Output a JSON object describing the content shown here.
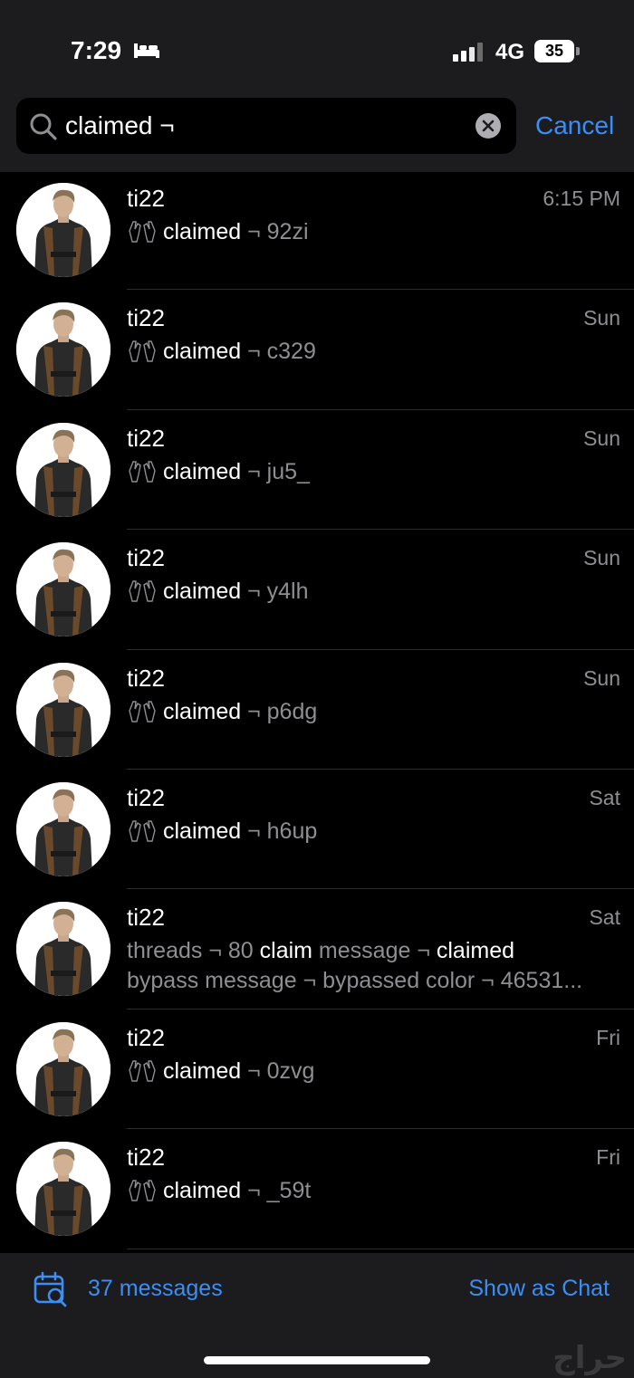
{
  "status_bar": {
    "time": "7:29",
    "network": "4G",
    "battery": "35"
  },
  "search": {
    "query": "claimed ¬",
    "cancel_label": "Cancel"
  },
  "messages": [
    {
      "sender": "ti22",
      "date": "6:15 PM",
      "prefix": "claimed",
      "suffix": " ¬ 92zi"
    },
    {
      "sender": "ti22",
      "date": "Sun",
      "prefix": "claimed",
      "suffix": " ¬ c329"
    },
    {
      "sender": "ti22",
      "date": "Sun",
      "prefix": "claimed",
      "suffix": " ¬ ju5_"
    },
    {
      "sender": "ti22",
      "date": "Sun",
      "prefix": "claimed",
      "suffix": " ¬ y4lh"
    },
    {
      "sender": "ti22",
      "date": "Sun",
      "prefix": "claimed",
      "suffix": " ¬ p6dg"
    },
    {
      "sender": "ti22",
      "date": "Sat",
      "prefix": "claimed",
      "suffix": " ¬ h6up"
    },
    {
      "sender": "ti22",
      "date": "Sat",
      "line1_a": "threads ¬ 80 ",
      "line1_b": "claim",
      "line1_c": " message ¬ ",
      "line1_d": "claimed",
      "line2": "bypass message ¬ bypassed color ¬ 46531..."
    },
    {
      "sender": "ti22",
      "date": "Fri",
      "prefix": "claimed",
      "suffix": " ¬ 0zvg"
    },
    {
      "sender": "ti22",
      "date": "Fri",
      "prefix": "claimed",
      "suffix": " ¬ _59t"
    }
  ],
  "footer": {
    "count_label": "37 messages",
    "show_as_chat_label": "Show as Chat",
    "watermark": "حراج"
  },
  "colors": {
    "accent": "#3a8ef6",
    "background": "#000000",
    "bar": "#1c1c1e"
  },
  "icons": [
    "sleep-icon",
    "signal-icon",
    "search-icon",
    "clear-icon",
    "hands-icon",
    "calendar-search-icon"
  ]
}
